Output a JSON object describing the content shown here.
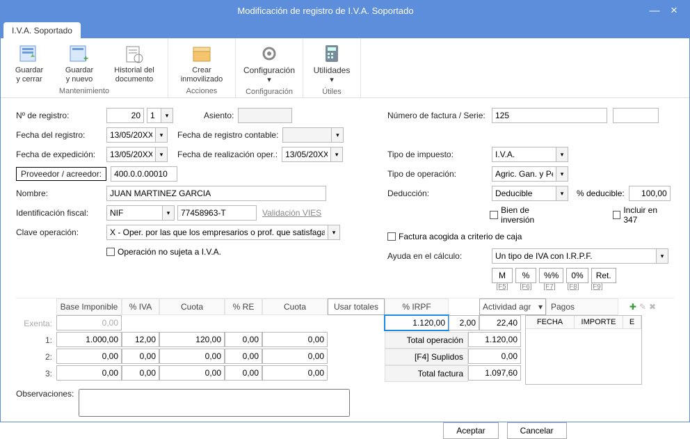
{
  "window": {
    "title": "Modificación de registro de I.V.A. Soportado"
  },
  "tab": {
    "label": "I.V.A. Soportado"
  },
  "ribbon": {
    "save_close": "Guardar\ny cerrar",
    "save_new": "Guardar\ny nuevo",
    "history": "Historial del\ndocumento",
    "maint_label": "Mantenimiento",
    "create_fixed": "Crear\ninmovilizado",
    "actions_label": "Acciones",
    "config": "Configuración",
    "config_label": "Configuración",
    "utils": "Utilidades",
    "utils_label": "Útiles"
  },
  "left": {
    "nreg_lbl": "Nº de registro:",
    "nreg_val": "20",
    "nreg_idx": "1",
    "freg_lbl": "Fecha del registro:",
    "freg_val": "13/05/20XX",
    "fexp_lbl": "Fecha de expedición:",
    "fexp_val": "13/05/20XX",
    "prov_lbl": "Proveedor / acreedor:",
    "prov_val": "400.0.0.00010",
    "nombre_lbl": "Nombre:",
    "nombre_val": "JUAN MARTINEZ GARCIA",
    "idfis_lbl": "Identificación fiscal:",
    "idfis_type": "NIF",
    "idfis_val": "77458963-T",
    "vies": "Validación VIES",
    "clave_lbl": "Clave operación:",
    "clave_val": "X - Oper. por las que los empresarios o prof. que satisfagan c",
    "nosuj_lbl": "Operación no sujeta a I.V.A.",
    "asiento_lbl": "Asiento:",
    "frcont_lbl": "Fecha de registro contable:",
    "froper_lbl": "Fecha de realización oper.:",
    "froper_val": "13/05/20XX"
  },
  "right": {
    "nfact_lbl": "Número de factura / Serie:",
    "nfact_val": "125",
    "tipoimp_lbl": "Tipo de impuesto:",
    "tipoimp_val": "I.V.A.",
    "tipoop_lbl": "Tipo de operación:",
    "tipoop_val": "Agric. Gan. y Pesca",
    "deduc_lbl": "Deducción:",
    "deduc_val": "Deducible",
    "pctded_lbl": "% deducible:",
    "pctded_val": "100,00",
    "bieninv_lbl": "Bien de inversión",
    "inc347_lbl": "Incluir en 347",
    "facaja_lbl": "Factura acogida a criterio de caja",
    "ayuda_lbl": "Ayuda en el cálculo:",
    "ayuda_val": "Un tipo de IVA con I.R.P.F.",
    "b_m": "M",
    "b_pct": "%",
    "b_pp": "%%",
    "b_0": "0%",
    "b_ret": "Ret.",
    "f5": "[F5]",
    "f6": "[F6]",
    "f7": "[F7]",
    "f8": "[F8]",
    "f9": "[F9]"
  },
  "grid": {
    "h_base": "Base Imponible",
    "h_iva": "% IVA",
    "h_cuota": "Cuota",
    "h_re": "% RE",
    "h_cuota2": "Cuota",
    "h_usar": "Usar totales",
    "h_irpf": "% IRPF",
    "h_act": "Actividad agr",
    "h_pagos": "Pagos",
    "exenta_lbl": "Exenta:",
    "r1": "1:",
    "r2": "2:",
    "r3": "3:",
    "exenta_base": "0,00",
    "base1": "1.000,00",
    "iva1": "12,00",
    "cuota1": "120,00",
    "re1": "0,00",
    "cuota1b": "0,00",
    "base2": "0,00",
    "iva2": "0,00",
    "cuota2": "0,00",
    "re2": "0,00",
    "cuota2b": "0,00",
    "base3": "0,00",
    "iva3": "0,00",
    "cuota3": "0,00",
    "re3": "0,00",
    "cuota3b": "0,00",
    "irpf_base": "1.120,00",
    "irpf_pct": "2,00",
    "irpf_cuota": "22,40",
    "totop_lbl": "Total operación",
    "totop_val": "1.120,00",
    "supl_lbl": "[F4] Suplidos",
    "supl_val": "0,00",
    "totfac_lbl": "Total factura",
    "totfac_val": "1.097,60",
    "pay_fecha": "FECHA",
    "pay_imp": "IMPORTE",
    "pay_e": "E"
  },
  "obs_lbl": "Observaciones:",
  "btn_ok": "Aceptar",
  "btn_cancel": "Cancelar"
}
